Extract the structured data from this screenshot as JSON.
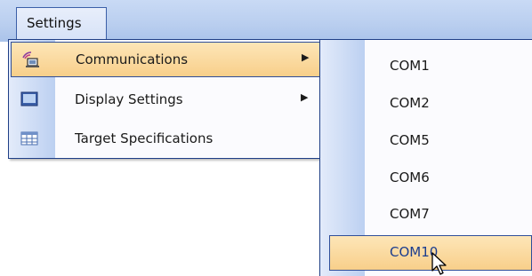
{
  "menubar": {
    "settings_label": "Settings"
  },
  "menu": {
    "items": [
      {
        "label": "Communications",
        "has_submenu": true,
        "icon": "network-icon",
        "highlighted": true
      },
      {
        "label": "Display Settings",
        "has_submenu": true,
        "icon": "monitor-icon"
      },
      {
        "label": "Target Specifications",
        "has_submenu": false,
        "icon": "grid-icon"
      }
    ],
    "submenu_arrow": "▶"
  },
  "submenu": {
    "items": [
      {
        "label": "COM1"
      },
      {
        "label": "COM2"
      },
      {
        "label": "COM5"
      },
      {
        "label": "COM6"
      },
      {
        "label": "COM7"
      },
      {
        "label": "COM10",
        "highlighted": true
      }
    ]
  },
  "colors": {
    "highlight_top": "#fde6b8",
    "highlight_bottom": "#f8cf8a",
    "border": "#1f3f86",
    "menubar": "#b9ceef"
  }
}
